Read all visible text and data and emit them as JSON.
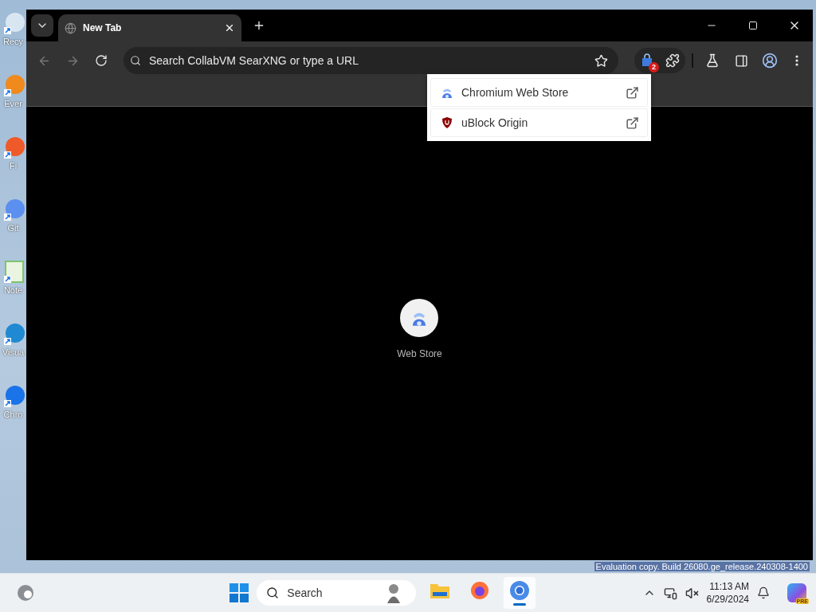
{
  "desktop_icons": [
    {
      "label": "Recy",
      "kind": "bin"
    },
    {
      "label": "Ever",
      "kind": "orange"
    },
    {
      "label": "Fi",
      "kind": "fire"
    },
    {
      "label": "Git",
      "kind": "git"
    },
    {
      "label": "Note",
      "kind": "notepad"
    },
    {
      "label": "Visua",
      "kind": "code"
    },
    {
      "label": "Chro",
      "kind": "chrome"
    }
  ],
  "browser": {
    "tab": {
      "title": "New Tab"
    },
    "address_bar": {
      "placeholder": "Search CollabVM SearXNG or type a URL"
    },
    "extensions_badge": "2",
    "extensions_menu": [
      {
        "name": "Chromium Web Store",
        "kind": "store"
      },
      {
        "name": "uBlock Origin",
        "kind": "ublock"
      }
    ],
    "shortcuts": [
      {
        "label": "Web Store"
      }
    ]
  },
  "watermark_text": "Evaluation copy. Build 26080.ge_release.240308-1400",
  "taskbar": {
    "search": {
      "placeholder": "Search"
    },
    "apps": [
      {
        "kind": "files",
        "active": false
      },
      {
        "kind": "firefox",
        "active": false
      },
      {
        "kind": "chromium",
        "active": true
      }
    ],
    "clock": {
      "time": "11:13 AM",
      "date": "6/29/2024"
    },
    "copilot_badge": "PRE"
  }
}
